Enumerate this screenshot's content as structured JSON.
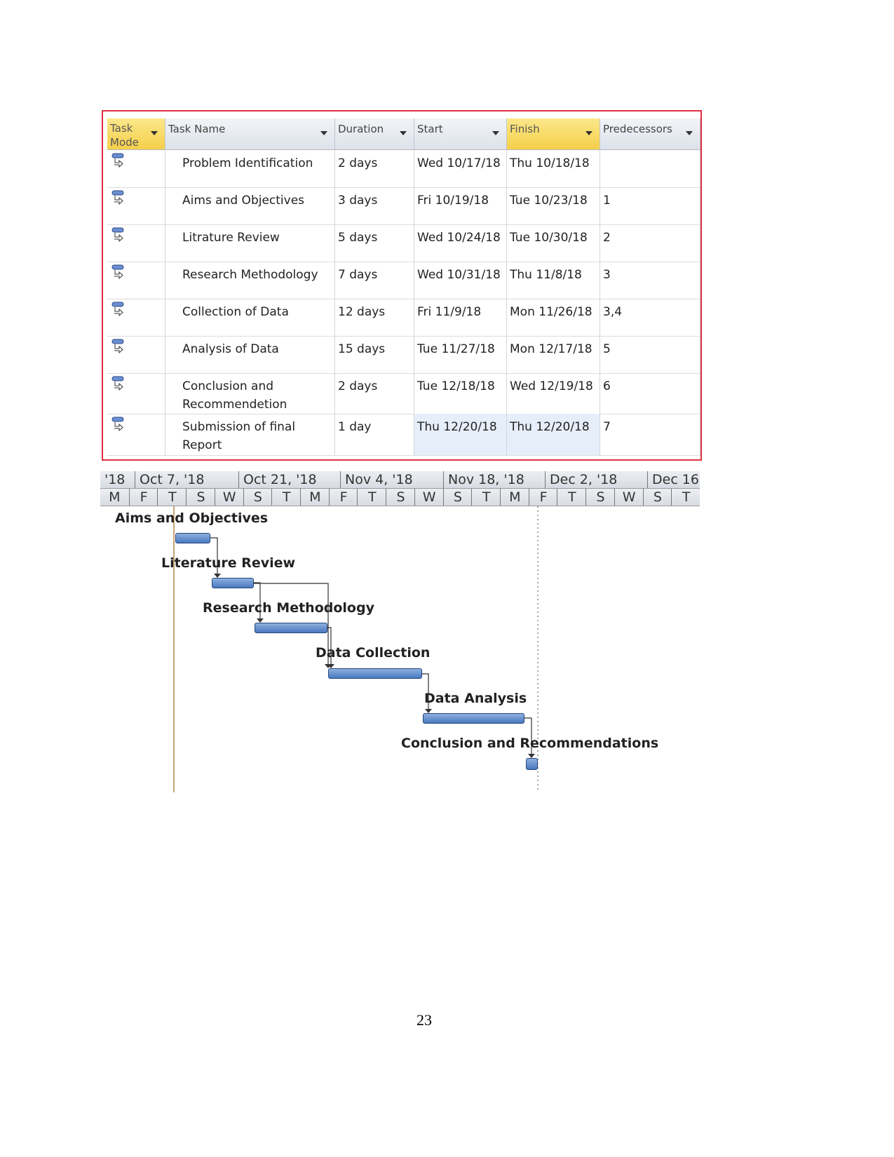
{
  "table": {
    "columns": [
      "Task Mode",
      "Task Name",
      "Duration",
      "Start",
      "Finish",
      "Predecessors"
    ],
    "rows": [
      {
        "name": "Problem Identification",
        "duration": "2 days",
        "start": "Wed 10/17/18",
        "finish": "Thu 10/18/18",
        "pred": ""
      },
      {
        "name": "Aims and Objectives",
        "duration": "3 days",
        "start": "Fri 10/19/18",
        "finish": "Tue 10/23/18",
        "pred": "1"
      },
      {
        "name": "Litrature Review",
        "duration": "5 days",
        "start": "Wed 10/24/18",
        "finish": "Tue 10/30/18",
        "pred": "2"
      },
      {
        "name": "Research Methodology",
        "duration": "7 days",
        "start": "Wed 10/31/18",
        "finish": "Thu 11/8/18",
        "pred": "3"
      },
      {
        "name": "Collection of Data",
        "duration": "12 days",
        "start": "Fri 11/9/18",
        "finish": "Mon 11/26/18",
        "pred": "3,4"
      },
      {
        "name": "Analysis of Data",
        "duration": "15 days",
        "start": "Tue 11/27/18",
        "finish": "Mon 12/17/18",
        "pred": "5"
      },
      {
        "name": "Conclusion and Recommendetion",
        "duration": "2 days",
        "start": "Tue 12/18/18",
        "finish": "Wed 12/19/18",
        "pred": "6"
      },
      {
        "name": "Submission of final Report",
        "duration": "1 day",
        "start": "Thu 12/20/18",
        "finish": "Thu 12/20/18",
        "pred": "7"
      }
    ],
    "task_mode_icon": "auto-scheduled-task-icon"
  },
  "timeline": {
    "major": [
      "'18",
      "Oct 7, '18",
      "Oct 21, '18",
      "Nov 4, '18",
      "Nov 18, '18",
      "Dec 2, '18",
      "Dec 16"
    ],
    "minor": [
      "M",
      "F",
      "T",
      "S",
      "W",
      "S",
      "T",
      "M",
      "F",
      "T",
      "S",
      "W",
      "S",
      "T",
      "M",
      "F",
      "T",
      "S",
      "W",
      "S",
      "T"
    ]
  },
  "gantt": {
    "labels": [
      "Aims and Objectives",
      "Literature Review",
      "Research Methodology",
      "Data Collection",
      "Data Analysis",
      "Conclusion and Recommendations"
    ],
    "bar_color": "#4a78c0"
  },
  "page_number": "23"
}
